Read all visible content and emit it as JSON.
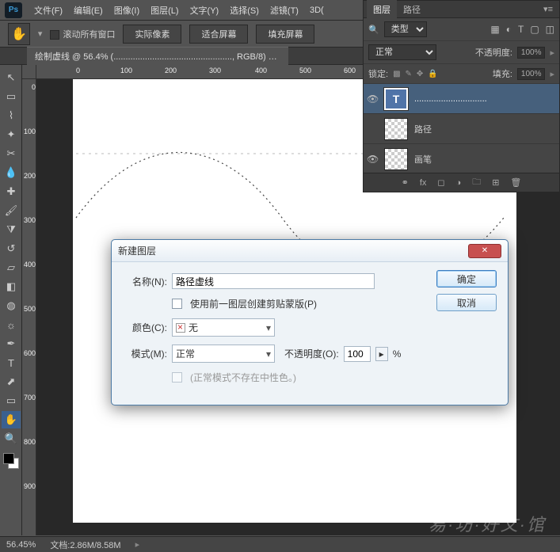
{
  "app": {
    "logo": "Ps"
  },
  "menu": {
    "file": "文件(F)",
    "edit": "编辑(E)",
    "image": "图像(I)",
    "layer": "图层(L)",
    "type": "文字(Y)",
    "select": "选择(S)",
    "filter": "滤镜(T)",
    "threeD": "3D("
  },
  "options": {
    "scroll_all": "滚动所有窗口",
    "actual": "实际像素",
    "fit": "适合屏幕",
    "fill": "填充屏幕"
  },
  "document": {
    "tab": "绘制虚线 @ 56.4% (................................................., RGB/8) *",
    "close_x": "×"
  },
  "ruler_h": {
    "m0": "0",
    "m1": "100",
    "m2": "200",
    "m3": "300",
    "m4": "400",
    "m5": "500",
    "m6": "600"
  },
  "ruler_v": {
    "m0": "0",
    "m1": "100",
    "m2": "200",
    "m3": "300",
    "m4": "400",
    "m5": "500",
    "m6": "600",
    "m7": "700",
    "m8": "800",
    "m9": "900"
  },
  "panel": {
    "tab_layers": "图层",
    "tab_paths": "路径",
    "kind": "类型",
    "blend": "正常",
    "opacity_label": "不透明度:",
    "opacity_value": "100%",
    "lock_label": "锁定:",
    "fill_label": "填充:",
    "fill_value": "100%",
    "layer1_thumb": "T",
    "layer1_name": "..............................",
    "layer2_name": "路径",
    "layer3_name": "画笔",
    "footer_icons": {
      "fx": "fx"
    }
  },
  "dialog": {
    "title": "新建图层",
    "name_label": "名称(N):",
    "name_value": "路径虚线",
    "clip_mask": "使用前一图层创建剪贴蒙版(P)",
    "color_label": "颜色(C):",
    "color_value": "无",
    "mode_label": "模式(M):",
    "mode_value": "正常",
    "opacity_label": "不透明度(O):",
    "opacity_value": "100",
    "opacity_unit": "%",
    "neutral_note": "(正常模式不存在中性色。)",
    "ok": "确定",
    "cancel": "取消"
  },
  "status": {
    "zoom": "56.45%",
    "doc": "文档:2.86M/8.58M"
  },
  "watermark": "易·坊·好文·馆"
}
